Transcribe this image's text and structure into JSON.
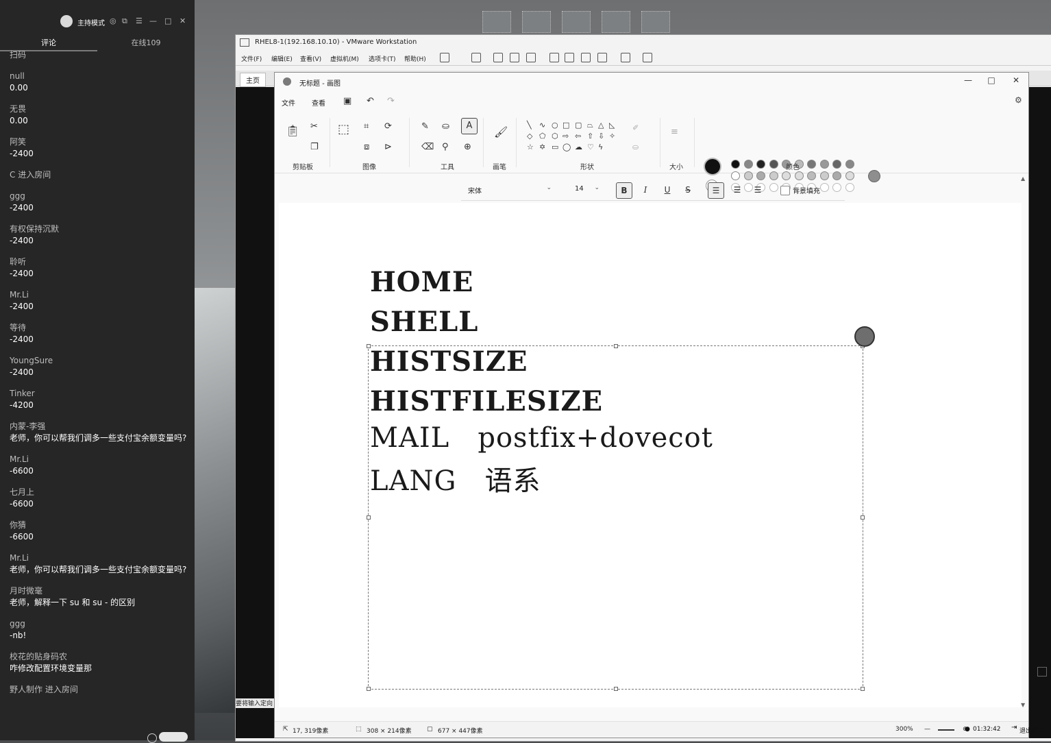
{
  "chat": {
    "mode_label": "主持模式",
    "tabs": [
      {
        "label": "评论"
      },
      {
        "label": "在线109"
      }
    ],
    "messages": [
      {
        "name": "扫码",
        "text": ""
      },
      {
        "name": "null",
        "text": "0.00"
      },
      {
        "name": "无畏",
        "text": "0.00"
      },
      {
        "name": "阿笑",
        "text": "-2400"
      },
      {
        "name": "C 进入房间",
        "text": ""
      },
      {
        "name": "ggg",
        "text": "-2400"
      },
      {
        "name": "有权保持沉默",
        "text": "-2400"
      },
      {
        "name": "聆听",
        "text": "-2400"
      },
      {
        "name": "Mr.Li",
        "text": "-2400"
      },
      {
        "name": "等待",
        "text": "-2400"
      },
      {
        "name": "YoungSure",
        "text": "-2400"
      },
      {
        "name": "Tinker",
        "text": "-4200"
      },
      {
        "name": "内蒙-李强",
        "text": "老师，你可以帮我们调多一些支付宝余额变量吗?"
      },
      {
        "name": "Mr.Li",
        "text": "-6600"
      },
      {
        "name": "七月上",
        "text": "-6600"
      },
      {
        "name": "你猜",
        "text": "-6600"
      },
      {
        "name": "Mr.Li",
        "text": "老师，你可以帮我们调多一些支付宝余额变量吗?"
      },
      {
        "name": "月时微毫",
        "text": "老师，解释一下 su 和 su - 的区别"
      },
      {
        "name": "ggg",
        "text": "-nb!"
      },
      {
        "name": "校花的贴身码农",
        "text": "咋修改配置环境变量那"
      },
      {
        "name": "野人制作 进入房间",
        "text": ""
      }
    ]
  },
  "vmware": {
    "title": "RHEL8-1(192.168.10.10) - VMware Workstation",
    "menu": [
      "文件(F)",
      "编辑(E)",
      "查看(V)",
      "虚拟机(M)",
      "选项卡(T)",
      "帮助(H)"
    ],
    "tab_home": "主页",
    "status_text": "要将输入定向"
  },
  "paint": {
    "title": "无标题 - 画图",
    "menu": {
      "file": "文件",
      "view": "查看"
    },
    "ribbon_groups": {
      "clipboard": "剪贴板",
      "image": "图像",
      "tools": "工具",
      "brushes": "画笔",
      "shapes": "形状",
      "size": "大小",
      "colors": "颜色"
    },
    "text_toolbar": {
      "font": "宋体",
      "size": "14",
      "bold": "B",
      "italic": "I",
      "underline": "U",
      "strike": "S",
      "background_fill": "背景填充"
    },
    "canvas_lines": [
      {
        "text": "HOME",
        "bold": true
      },
      {
        "text": "SHELL",
        "bold": true
      },
      {
        "text": "HISTSIZE",
        "bold": true
      },
      {
        "text": "HISTFILESIZE",
        "bold": true
      },
      {
        "text": "MAIL   postfix+dovecot",
        "bold": false
      },
      {
        "text": "LANG   语系",
        "bold": false
      }
    ],
    "status": {
      "cursor": "17, 319像素",
      "selection": "308 × 214像素",
      "canvas": "677 × 447像素",
      "zoom": "300%"
    }
  },
  "tray": {
    "time": "01:32:42",
    "exit_share": "退出分享"
  }
}
